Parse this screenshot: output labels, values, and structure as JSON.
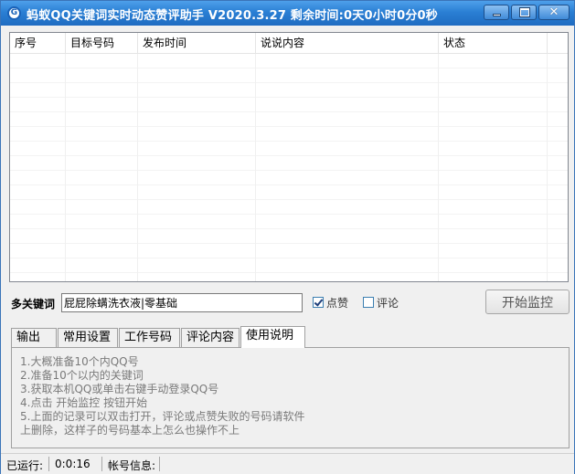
{
  "window": {
    "icon_letter": "G",
    "title": "蚂蚁QQ关键词实时动态赞评助手 V2020.3.27 剩余时间:0天0小时0分0秒",
    "close_glyph": "✕"
  },
  "table": {
    "columns": [
      "序号",
      "目标号码",
      "发布时间",
      "说说内容",
      "状态"
    ],
    "rows": []
  },
  "keyword": {
    "label": "多关键词",
    "value": "屁屁除螨洗衣液|零基础"
  },
  "options": {
    "like_label": "点赞",
    "like_checked": true,
    "comment_label": "评论",
    "comment_checked": false
  },
  "start_button": "开始监控",
  "tabs": {
    "items": [
      "输出",
      "常用设置",
      "工作号码",
      "评论内容",
      "使用说明"
    ],
    "active_index": 4
  },
  "instructions": [
    "1.大概准备10个内QQ号",
    "2.准备10个以内的关键词",
    "3.获取本机QQ或单击右键手动登录QQ号",
    "4.点击 开始监控 按钮开始",
    "5.上面的记录可以双击打开，评论或点赞失败的号码请软件",
    "上删除，这样子的号码基本上怎么也操作不上"
  ],
  "status": {
    "running_label": "已运行:",
    "running_value": "0:0:16",
    "account_label": "帐号信息:"
  },
  "colors": {
    "titlebar": "#2a7fd4",
    "window_bg": "#f0f0f0"
  }
}
